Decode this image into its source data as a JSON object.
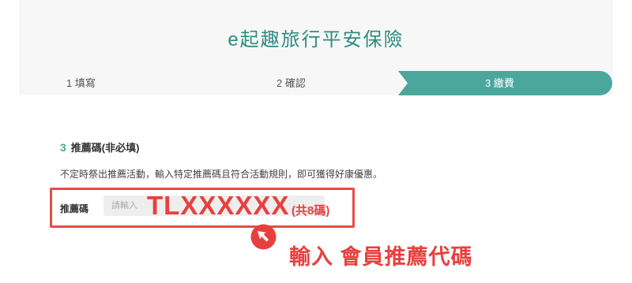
{
  "header": {
    "title": "e起趣旅行平安保險"
  },
  "steps": [
    {
      "label": "1 填寫"
    },
    {
      "label": "2 確認"
    },
    {
      "label": "3 繳費"
    }
  ],
  "section": {
    "number": "3",
    "heading": "推薦碼(非必填)",
    "description": "不定時祭出推薦活動，輸入特定推薦碼且符合活動規則，即可獲得好康優惠。"
  },
  "referral_field": {
    "label": "推薦碼",
    "placeholder": "請輸入"
  },
  "overlay": {
    "code_example": "TLXXXXXX",
    "code_length_note": "(共8碼)",
    "annotation": "輸入 會員推薦代碼",
    "pointer_icon": "arrow-pointer-icon"
  },
  "colors": {
    "accent": "#3ea99a",
    "title": "#2e8b80",
    "highlight": "#e8403e"
  }
}
